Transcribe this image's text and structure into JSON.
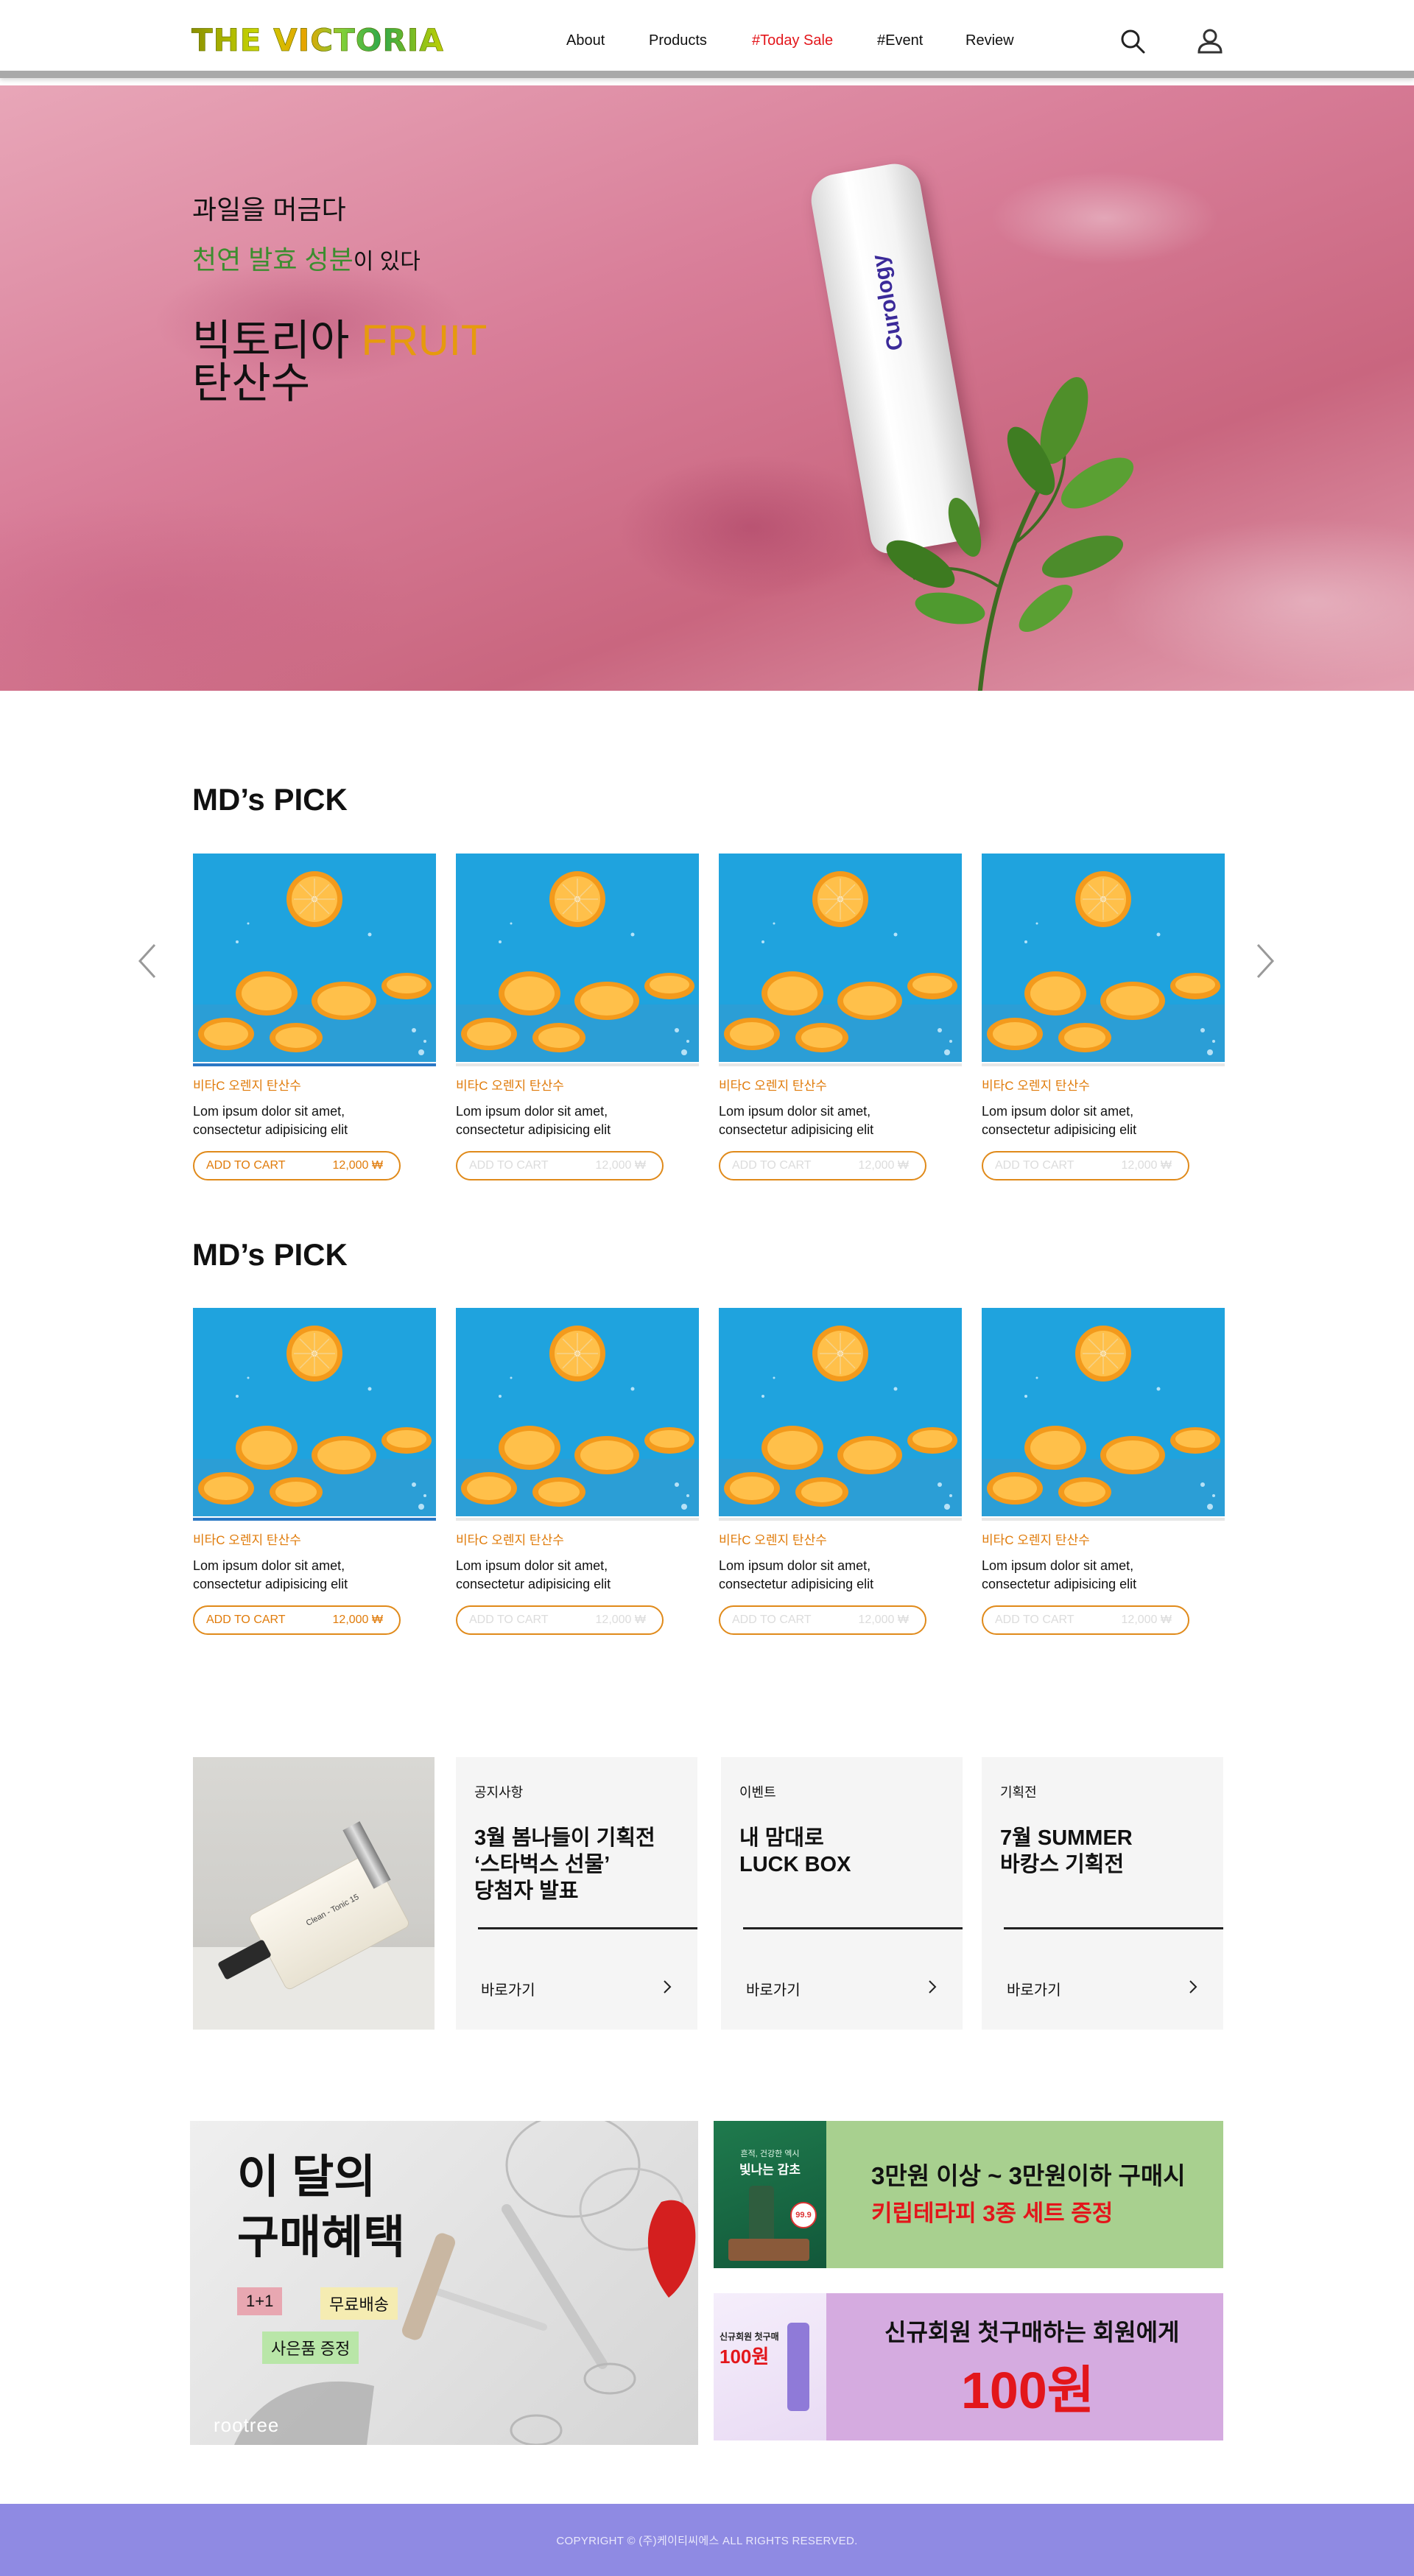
{
  "header": {
    "logo": "THE VICTORIA",
    "nav": [
      "About",
      "Products",
      "#Today Sale",
      "#Event",
      "Review"
    ]
  },
  "hero": {
    "line1": "과일을 머금다",
    "line2_green": "천연 발효 성분",
    "line2_rest": "이 있다",
    "title_part1": "빅토리아 ",
    "title_fruit": "FRUIT",
    "title_line2": "탄산수",
    "bottle_brand": "Curology"
  },
  "md_pick_1": {
    "title": "MD’s PICK",
    "cards": [
      {
        "category": "비타C 오렌지 탄산수",
        "desc1": "Lom ipsum dolor sit amet,",
        "desc2": "consectetur adipisicing elit",
        "btn": "ADD TO CART",
        "price": "12,000 ₩"
      },
      {
        "category": "비타C 오렌지 탄산수",
        "desc1": "Lom ipsum dolor sit amet,",
        "desc2": "consectetur adipisicing elit",
        "btn": "ADD TO CART",
        "price": "12,000 ₩"
      },
      {
        "category": "비타C 오렌지 탄산수",
        "desc1": "Lom ipsum dolor sit amet,",
        "desc2": "consectetur adipisicing elit",
        "btn": "ADD TO CART",
        "price": "12,000 ₩"
      },
      {
        "category": "비타C 오렌지 탄산수",
        "desc1": "Lom ipsum dolor sit amet,",
        "desc2": "consectetur adipisicing elit",
        "btn": "ADD TO CART",
        "price": "12,000 ₩"
      }
    ]
  },
  "md_pick_2": {
    "title": "MD’s PICK",
    "cards": [
      {
        "category": "비타C 오렌지 탄산수",
        "desc1": "Lom ipsum dolor sit amet,",
        "desc2": "consectetur adipisicing elit",
        "btn": "ADD TO CART",
        "price": "12,000 ₩"
      },
      {
        "category": "비타C 오렌지 탄산수",
        "desc1": "Lom ipsum dolor sit amet,",
        "desc2": "consectetur adipisicing elit",
        "btn": "ADD TO CART",
        "price": "12,000 ₩"
      },
      {
        "category": "비타C 오렌지 탄산수",
        "desc1": "Lom ipsum dolor sit amet,",
        "desc2": "consectetur adipisicing elit",
        "btn": "ADD TO CART",
        "price": "12,000 ₩"
      },
      {
        "category": "비타C 오렌지 탄산수",
        "desc1": "Lom ipsum dolor sit amet,",
        "desc2": "consectetur adipisicing elit",
        "btn": "ADD TO CART",
        "price": "12,000 ₩"
      }
    ]
  },
  "notices": [
    {
      "tag": "공지사항",
      "title1": "3월 봄나들이 기획전",
      "title2": "‘스타벅스 선물’",
      "title3": "당첨자 발표",
      "more": "바로가기"
    },
    {
      "tag": "이벤트",
      "title1": "내 맘대로",
      "title2": "LUCK BOX",
      "title3": "",
      "more": "바로가기"
    },
    {
      "tag": "기획전",
      "title1": "7월 SUMMER",
      "title2": "바캉스 기획전",
      "title3": "",
      "more": "바로가기"
    }
  ],
  "perfume_label": "Clean - Tonic 15",
  "promo_main": {
    "title1": "이 달의",
    "title2": "구매혜택",
    "badge_1plus1": "1+1",
    "badge_shipping": "무료배송",
    "badge_gift": "사은품 증정",
    "brand": "rootree"
  },
  "promo_1": {
    "text1": "3만원 이상 ~ 3만원이하 구매시",
    "text2": "키립테라피 3종 세트 증정",
    "thumb_line1": "흔적, 건강한 엑시",
    "thumb_line2": "빛나는 감초",
    "thumb_badge": "99.9"
  },
  "promo_2": {
    "text1": "신규회원 첫구매하는 회원에게",
    "text2": "100원",
    "thumb_line1": "신규회원 첫구매",
    "thumb_line2": "100원"
  },
  "footer": {
    "copyright": "COPYRIGHT © (주)케이티씨에스 ALL RIGHTS RESERVED."
  },
  "colors": {
    "accent_orange": "#e07b0a",
    "sale_red": "#e3161b",
    "footer_bg": "#8f8ae3",
    "promo1_bg": "#a8d08f",
    "promo2_bg": "#d5abe0"
  }
}
